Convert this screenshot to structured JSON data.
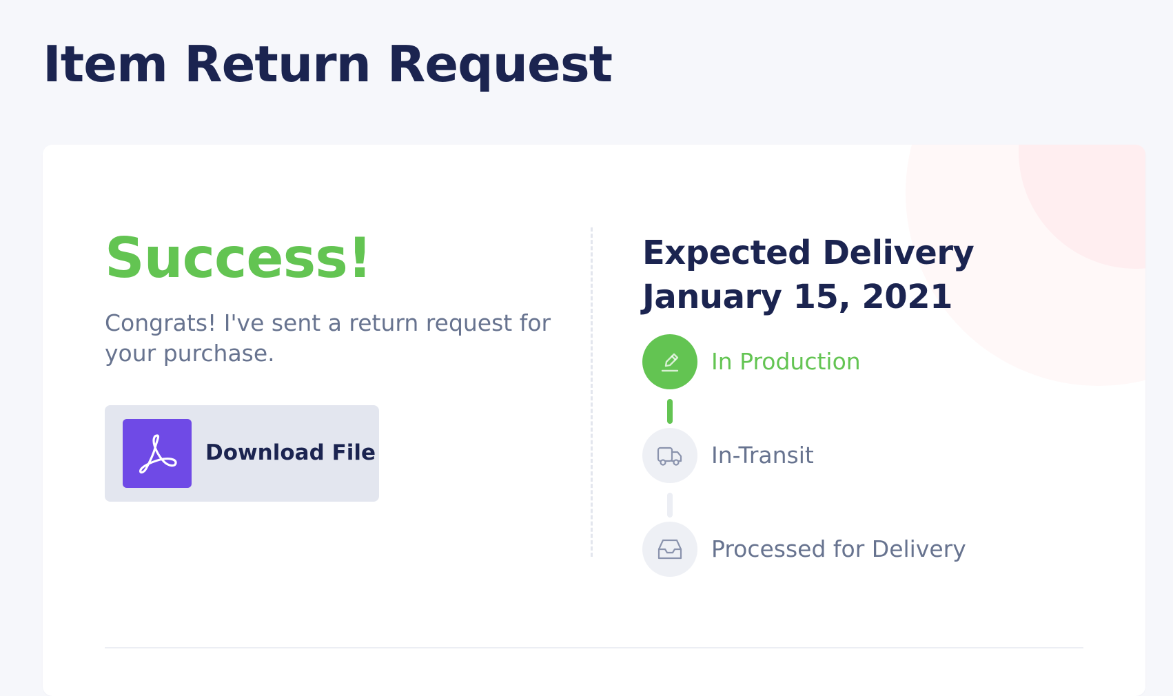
{
  "page": {
    "title": "Item Return Request"
  },
  "result": {
    "heading": "Success!",
    "message": "Congrats! I've sent a return request for your purchase."
  },
  "download": {
    "label": "Download File",
    "icon": "pdf-file-icon"
  },
  "delivery": {
    "heading_line1": "Expected Delivery",
    "heading_line2": "January 15, 2021"
  },
  "timeline": {
    "steps": [
      {
        "label": "In Production",
        "icon": "pencil-icon",
        "status": "active"
      },
      {
        "label": "In-Transit",
        "icon": "truck-icon",
        "status": "pending"
      },
      {
        "label": "Processed for Delivery",
        "icon": "inbox-tray-icon",
        "status": "pending"
      }
    ]
  },
  "colors": {
    "success": "#63c452",
    "heading": "#1b2450",
    "muted_text": "#67738f",
    "pdf_tile": "#6f4ae6",
    "button_bg": "#e3e6ef",
    "page_bg": "#f6f7fb"
  }
}
